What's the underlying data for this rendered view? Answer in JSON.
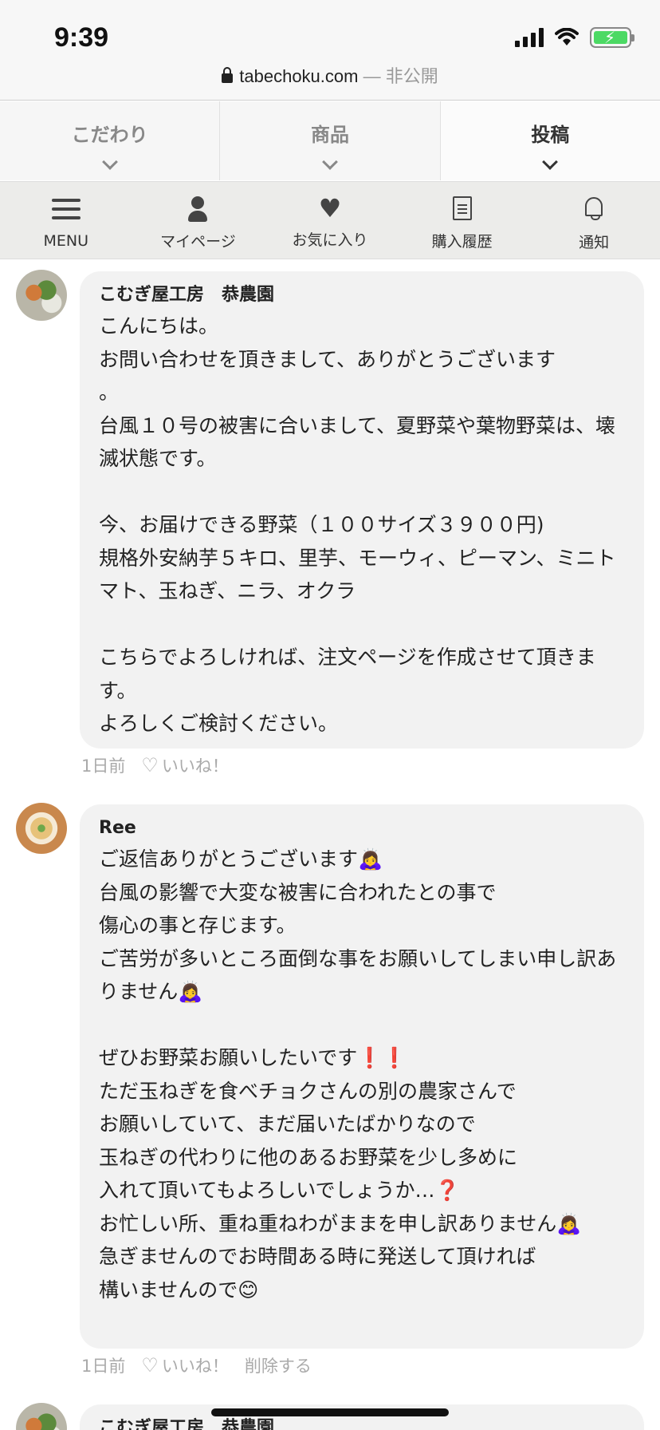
{
  "status": {
    "time": "9:39"
  },
  "url": {
    "domain": "tabechoku.com",
    "suffix": "— 非公開"
  },
  "tabs": [
    {
      "label": "こだわり"
    },
    {
      "label": "商品"
    },
    {
      "label": "投稿"
    }
  ],
  "nav": [
    {
      "label": "MENU",
      "icon": "menu-icon"
    },
    {
      "label": "マイページ",
      "icon": "person-icon"
    },
    {
      "label": "お気に入り",
      "icon": "heart-icon"
    },
    {
      "label": "購入履歴",
      "icon": "document-icon"
    },
    {
      "label": "通知",
      "icon": "bell-icon"
    }
  ],
  "messages": [
    {
      "sender": "こむぎ屋工房　恭農園",
      "text": "こんにちは。\nお問い合わせを頂きまして、ありがとうございます\n。\n台風１０号の被害に合いまして、夏野菜や葉物野菜は、壊滅状態です。\n\n今、お届けできる野菜（１００サイズ３９００円)\n規格外安納芋５キロ、里芋、モーウィ、ピーマン、ミニトマト、玉ねぎ、ニラ、オクラ\n\nこちらでよろしければ、注文ページを作成させて頂きます。\nよろしくご検討ください。",
      "time": "1日前",
      "like": "いいね！"
    },
    {
      "sender": "Ree",
      "text": "ご返信ありがとうございます🙇‍♀️\n台風の影響で大変な被害に合われたとの事で\n傷心の事と存じます。\nご苦労が多いところ面倒な事をお願いしてしまい申し訳ありません🙇‍♀️\n\nぜひお野菜お願いしたいです❗️❗️\nただ玉ねぎを食べチョクさんの別の農家さんで\nお願いしていて、まだ届いたばかりなので\n玉ねぎの代わりに他のあるお野菜を少し多めに\n入れて頂いてもよろしいでしょうか…❓\nお忙しい所、重ね重ねわがままを申し訳ありません🙇‍♀️\n急ぎませんのでお時間ある時に発送して頂ければ\n構いませんので😊",
      "time": "1日前",
      "like": "いいね！",
      "delete": "削除する"
    },
    {
      "sender": "こむぎ屋工房　恭農園"
    }
  ]
}
